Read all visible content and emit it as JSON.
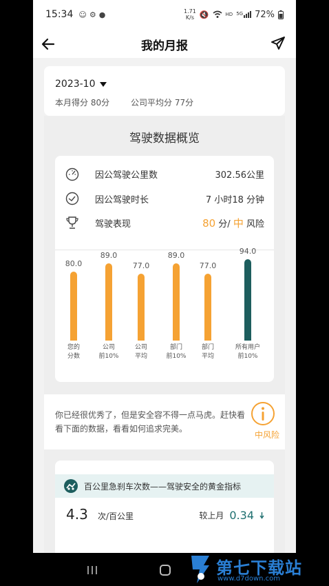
{
  "status_bar": {
    "time": "15:34",
    "net_speed_top": "1.71",
    "net_speed_unit": "K/s",
    "hd": "HD",
    "signal_label": "5G",
    "battery_pct": "72%"
  },
  "header": {
    "title": "我的月报"
  },
  "summary": {
    "month": "2023-10",
    "my_score": "本月得分 80分",
    "company_avg": "公司平均分 77分"
  },
  "overview": {
    "title": "驾驶数据概览",
    "mileage_label": "因公驾驶公里数",
    "mileage_value": "302.56公里",
    "duration_label": "因公驾驶时长",
    "duration_value": "7 小时18 分钟",
    "performance_label": "驾驶表现",
    "performance_score": "80",
    "performance_unit": "分/",
    "performance_risk": "中",
    "performance_risk_suffix": "风险"
  },
  "chart_data": {
    "type": "bar",
    "categories": [
      "您的分数",
      "公司前10%",
      "公司平均",
      "部门前10%",
      "部门平均",
      "所有用户前10%"
    ],
    "category_lines": [
      [
        "您的",
        "分数"
      ],
      [
        "公司",
        "前10%"
      ],
      [
        "公司",
        "平均"
      ],
      [
        "部门",
        "前10%"
      ],
      [
        "部门",
        "平均"
      ],
      [
        "所有用户",
        "前10%"
      ]
    ],
    "values": [
      80.0,
      89.0,
      77.0,
      89.0,
      77.0,
      94.0
    ],
    "value_labels": [
      "80.0",
      "89.0",
      "77.0",
      "89.0",
      "77.0",
      "94.0"
    ],
    "colors": [
      "#f5a233",
      "#f5a233",
      "#f5a233",
      "#f5a233",
      "#f5a233",
      "#1d5e5e"
    ],
    "ylim": [
      0,
      94
    ]
  },
  "notice": {
    "text": "你已经很优秀了，但是安全容不得一点马虎。赶快看看下面的数据，看看如何追求完美。",
    "risk_label": "中风险"
  },
  "brake": {
    "title": "百公里急刹车次数——驾驶安全的黄金指标",
    "value": "4.3",
    "unit": "次/百公里",
    "compare_label": "较上月",
    "compare_value": "0.34"
  },
  "watermark": {
    "brand": "第七下载站",
    "url": "www.d7down.com"
  },
  "colors": {
    "accent_orange": "#f5a233",
    "accent_teal": "#1d5e5e",
    "watermark_blue": "#2a7fd4"
  }
}
